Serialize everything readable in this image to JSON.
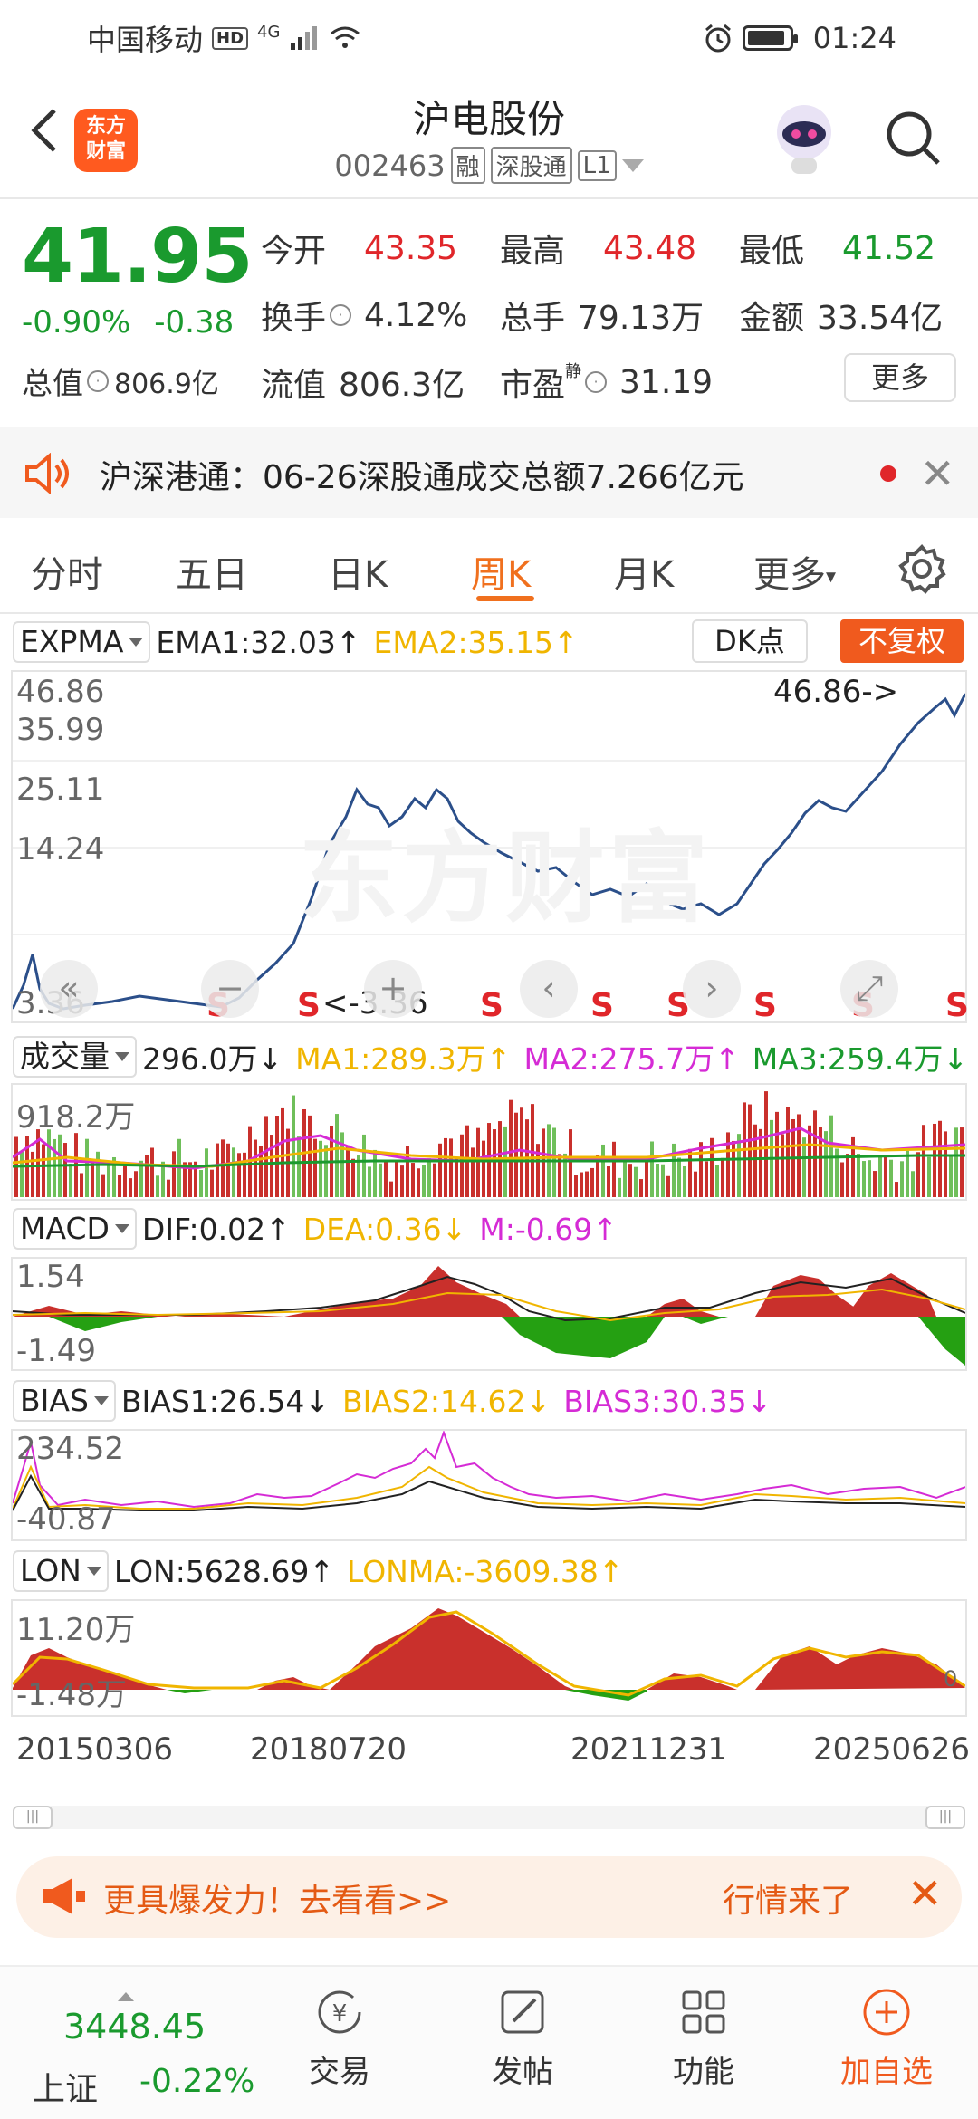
{
  "status_bar": {
    "carrier": "中国移动",
    "hd": "HD",
    "network": "4G",
    "time": "01:24"
  },
  "header": {
    "title": "沪电股份",
    "code": "002463",
    "tags": [
      "融",
      "深股通",
      "L1"
    ],
    "logo_text_1": "东方",
    "logo_text_2": "财富"
  },
  "quote": {
    "price": "41.95",
    "change_pct": "-0.90%",
    "change_abs": "-0.38",
    "fields": [
      {
        "label": "今开",
        "value": "43.35"
      },
      {
        "label": "最高",
        "value": "43.48"
      },
      {
        "label": "最低",
        "value": "41.52"
      },
      {
        "label": "换手",
        "value": "4.12%"
      },
      {
        "label": "总手",
        "value": "79.13万"
      },
      {
        "label": "金额",
        "value": "33.54亿"
      },
      {
        "label": "总值",
        "value": "806.9亿"
      },
      {
        "label": "流值",
        "value": "806.3亿"
      },
      {
        "label": "市盈",
        "value": "31.19",
        "superscript": "静"
      }
    ],
    "more_label": "更多"
  },
  "news": {
    "text": "沪深港通：06-26深股通成交总额7.266亿元"
  },
  "tabs": [
    "分时",
    "五日",
    "日K",
    "周K",
    "月K",
    "更多"
  ],
  "active_tab": "周K",
  "expma": {
    "name": "EXPMA",
    "ema1": "EMA1:32.03",
    "ema2": "EMA2:35.15",
    "dk_label": "DK点",
    "adj_label": "不复权"
  },
  "price_axis": [
    "46.86",
    "35.99",
    "25.11",
    "14.24",
    "3.36"
  ],
  "price_high_label": "46.86->",
  "price_low_label": "<-3.36",
  "s_marks": [
    "S",
    "S",
    "S",
    "S",
    "S",
    "S",
    "S",
    "S",
    "S"
  ],
  "volume": {
    "name": "成交量",
    "value": "296.0万",
    "ma1": "MA1:289.3万",
    "ma2": "MA2:275.7万",
    "ma3": "MA3:259.4万",
    "axis_top": "918.2万"
  },
  "macd": {
    "name": "MACD",
    "dif": "DIF:0.02",
    "dea": "DEA:0.36",
    "m": "M:-0.69",
    "axis_top": "1.54",
    "axis_bottom": "-1.49"
  },
  "bias": {
    "name": "BIAS",
    "b1": "BIAS1:26.54",
    "b2": "BIAS2:14.62",
    "b3": "BIAS3:30.35",
    "axis_top": "234.52",
    "axis_bottom": "-40.87"
  },
  "lon": {
    "name": "LON",
    "lon": "LON:5628.69",
    "lonma": "LONMA:-3609.38",
    "axis_top": "11.20万",
    "axis_bottom": "-1.48万",
    "axis_zero": "0"
  },
  "dates": [
    "20150306",
    "20180720",
    "20211231",
    "20250626"
  ],
  "ad_bar": {
    "text": "更具爆发力！去看看>>",
    "right_text": "行情来了"
  },
  "bottom_nav": {
    "index_value": "3448.45",
    "index_name": "上证",
    "index_pct": "-0.22%",
    "items": [
      "交易",
      "发帖",
      "功能",
      "加自选"
    ]
  },
  "colors": {
    "up": "#e0262a",
    "down": "#1a9a2e",
    "accent": "#f05a1e",
    "ema2": "#f0b500",
    "ma2": "#d52bd5"
  }
}
